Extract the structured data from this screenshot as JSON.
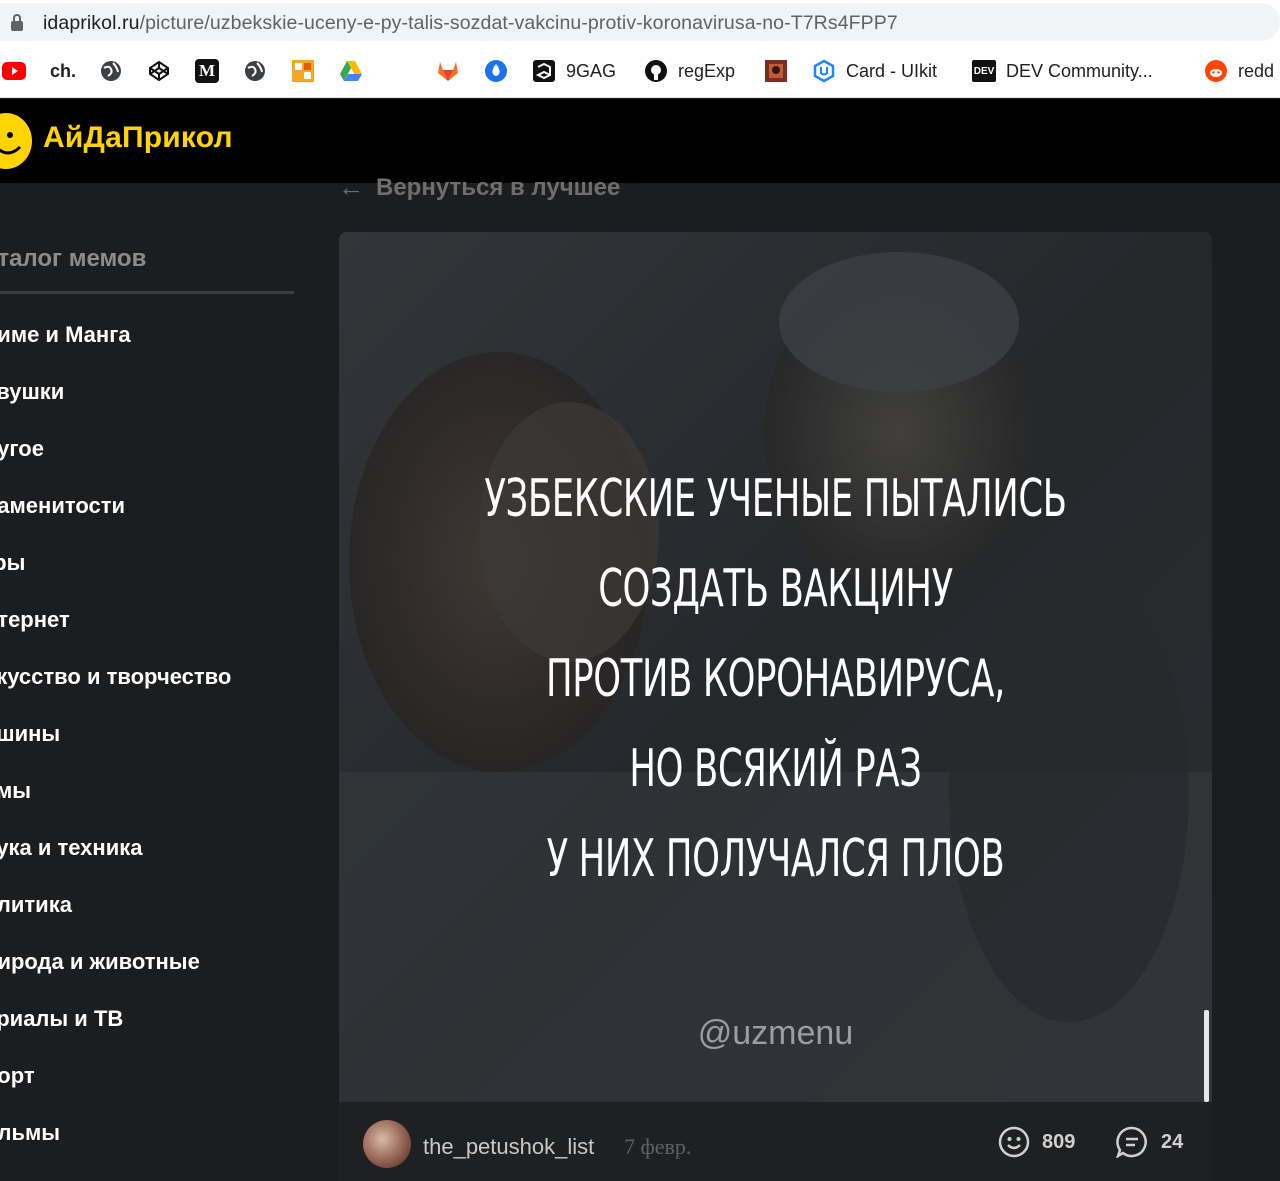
{
  "browser": {
    "url_host": "idaprikol.ru",
    "url_path": "/picture/uzbekskie-uceny-e-py-talis-sozdat-vakcinu-protiv-koronavirusa-no-T7Rs4FPP7"
  },
  "bookmarks": [
    {
      "icon": "youtube-icon",
      "label": ""
    },
    {
      "icon": "ch-icon",
      "label": "ch."
    },
    {
      "icon": "globe-icon",
      "label": ""
    },
    {
      "icon": "codepen-icon",
      "label": ""
    },
    {
      "icon": "medium-icon",
      "label": "M"
    },
    {
      "icon": "globe-icon",
      "label": ""
    },
    {
      "icon": "grid-icon",
      "label": ""
    },
    {
      "icon": "drive-icon",
      "label": ""
    },
    {
      "icon": "gitlab-icon",
      "label": ""
    },
    {
      "icon": "drop-icon",
      "label": ""
    },
    {
      "icon": "9gag-icon",
      "label": "9GAG"
    },
    {
      "icon": "github-icon",
      "label": "regExp"
    },
    {
      "icon": "image-icon",
      "label": ""
    },
    {
      "icon": "uikit-icon",
      "label": "Card - UIkit"
    },
    {
      "icon": "dev-icon",
      "label": "DEV Community..."
    },
    {
      "icon": "reddit-icon",
      "label": "redd"
    }
  ],
  "site": {
    "logo_text": "АйДаПрикол",
    "accent": "#ffd400"
  },
  "sidebar": {
    "title": "аталог мемов",
    "items": [
      "ниме и Манга",
      "евушки",
      "ругое",
      "наменитости",
      "гры",
      "нтернет",
      "скусство и творчество",
      "ашины",
      "емы",
      "аука и техника",
      "олитика",
      "рирода и животные",
      "ериалы и ТВ",
      "порт",
      "ильмы"
    ]
  },
  "back_link": "Вернуться в лучшее",
  "post": {
    "caption_lines": [
      "УЗБЕКСКИЕ УЧЕНЫЕ ПЫТАЛИСЬ",
      "СОЗДАТЬ ВАКЦИНУ",
      "ПРОТИВ КОРОНАВИРУСА,",
      "НО ВСЯКИЙ РАЗ",
      "У НИХ ПОЛУЧАЛСЯ ПЛОВ"
    ],
    "watermark": "@uzmenu",
    "author": "the_petushok_list",
    "date": "7 февр.",
    "likes": "809",
    "comments": "24"
  }
}
